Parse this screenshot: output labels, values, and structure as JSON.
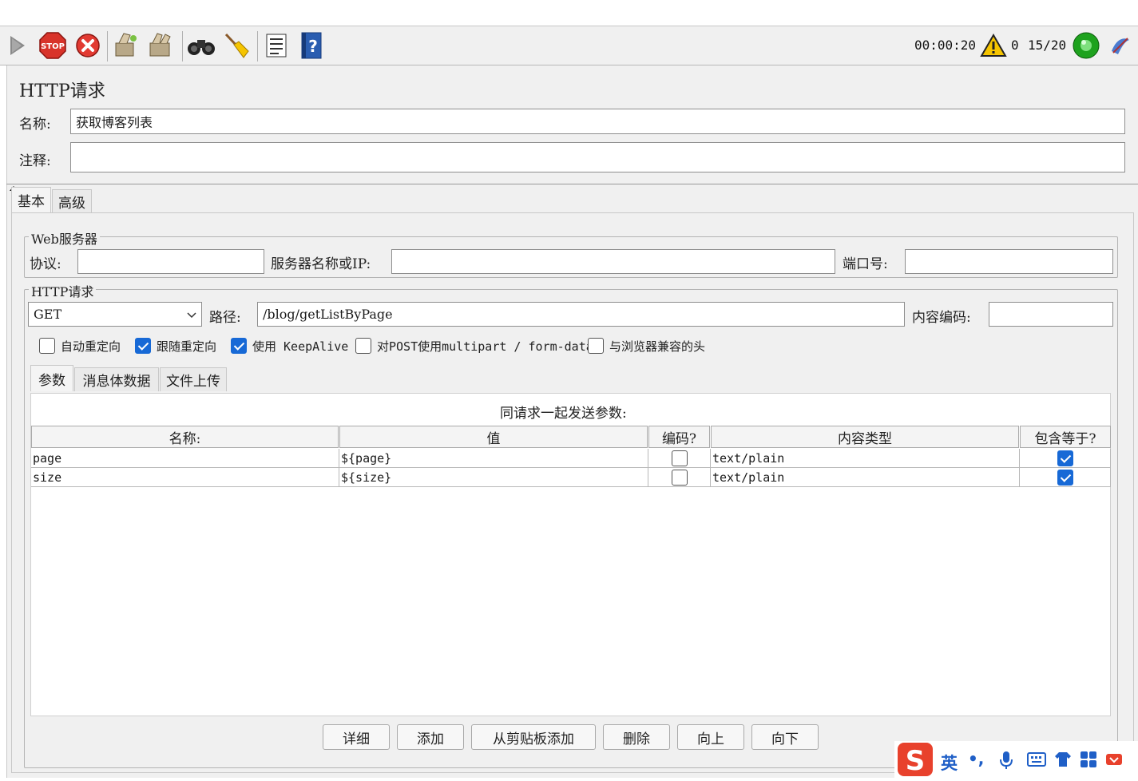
{
  "toolbar": {
    "timer": "00:00:20",
    "warn_count": "0",
    "threads": "15/20",
    "colors": {
      "stop_red": "#d8332a",
      "run_green": "#1ea21e",
      "warn_yellow": "#f5c400",
      "help_blue": "#2a5db0"
    }
  },
  "header": {
    "title": "HTTP请求",
    "name_label": "名称:",
    "name_value": "获取博客列表",
    "comment_label": "注释:",
    "comment_value": ""
  },
  "tabs": {
    "basic": "基本",
    "advanced": "高级"
  },
  "web_server": {
    "title": "Web服务器",
    "protocol_label": "协议:",
    "protocol_value": "",
    "server_label": "服务器名称或IP:",
    "server_value": "",
    "port_label": "端口号:",
    "port_value": ""
  },
  "http_request": {
    "title": "HTTP请求",
    "method": "GET",
    "path_label": "路径:",
    "path_value": "/blog/getListByPage",
    "encoding_label": "内容编码:",
    "encoding_value": ""
  },
  "options": [
    {
      "label": "自动重定向",
      "checked": false
    },
    {
      "label": "跟随重定向",
      "checked": true
    },
    {
      "label": "使用 KeepAlive",
      "checked": true
    },
    {
      "label": "对POST使用multipart / form-data",
      "checked": false
    },
    {
      "label": "与浏览器兼容的头",
      "checked": false
    }
  ],
  "subtabs": {
    "params": "参数",
    "body": "消息体数据",
    "files": "文件上传"
  },
  "params_table": {
    "caption": "同请求一起发送参数:",
    "headers": [
      "名称:",
      "值",
      "编码?",
      "内容类型",
      "包含等于?"
    ],
    "rows": [
      {
        "name": "page",
        "value": "${page}",
        "encode": false,
        "content_type": "text/plain",
        "include_equals": true
      },
      {
        "name": "size",
        "value": "${size}",
        "encode": false,
        "content_type": "text/plain",
        "include_equals": true
      }
    ]
  },
  "buttons": {
    "detail": "详细",
    "add": "添加",
    "add_clipboard": "从剪贴板添加",
    "delete": "删除",
    "up": "向上",
    "down": "向下"
  },
  "ime": {
    "mode": "英",
    "punct": "•,"
  }
}
